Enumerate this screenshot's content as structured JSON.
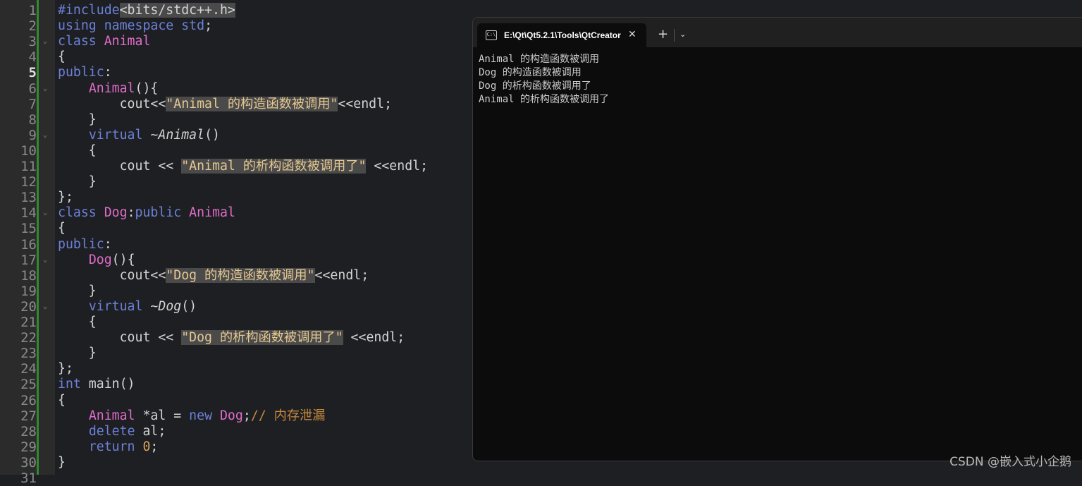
{
  "editor": {
    "line_numbers": [
      "1",
      "2",
      "3",
      "4",
      "5",
      "6",
      "7",
      "8",
      "9",
      "10",
      "11",
      "12",
      "13",
      "14",
      "15",
      "16",
      "17",
      "18",
      "19",
      "20",
      "21",
      "22",
      "23",
      "24",
      "25",
      "26",
      "27",
      "28",
      "29",
      "30",
      "31"
    ],
    "current_line": 5,
    "fold_lines": [
      3,
      6,
      9,
      14,
      17,
      20
    ],
    "code": [
      [
        [
          "pp",
          "#include"
        ],
        [
          "inc",
          "<bits/stdc++.h>"
        ]
      ],
      [
        [
          "kw",
          "using"
        ],
        [
          "plain",
          " "
        ],
        [
          "kw",
          "namespace"
        ],
        [
          "plain",
          " "
        ],
        [
          "kw",
          "std"
        ],
        [
          "plain",
          ";"
        ]
      ],
      [
        [
          "kw",
          "class"
        ],
        [
          "plain",
          " "
        ],
        [
          "cls",
          "Animal"
        ]
      ],
      [
        [
          "plain",
          "{"
        ]
      ],
      [
        [
          "kw",
          "public"
        ],
        [
          "plain",
          ":"
        ]
      ],
      [
        [
          "plain",
          "    "
        ],
        [
          "fn",
          "Animal"
        ],
        [
          "plain",
          "(){"
        ]
      ],
      [
        [
          "plain",
          "        cout<<"
        ],
        [
          "str",
          "\"Animal 的构造函数被调用\""
        ],
        [
          "plain",
          "<<endl;"
        ]
      ],
      [
        [
          "plain",
          "    }"
        ]
      ],
      [
        [
          "plain",
          "    "
        ],
        [
          "kw",
          "virtual"
        ],
        [
          "plain",
          " ~"
        ],
        [
          "it",
          "Animal"
        ],
        [
          "plain",
          "()"
        ]
      ],
      [
        [
          "plain",
          "    {"
        ]
      ],
      [
        [
          "plain",
          "        cout << "
        ],
        [
          "str",
          "\"Animal 的析构函数被调用了\""
        ],
        [
          "plain",
          " <<endl;"
        ]
      ],
      [
        [
          "plain",
          "    }"
        ]
      ],
      [
        [
          "plain",
          "};"
        ]
      ],
      [
        [
          "kw",
          "class"
        ],
        [
          "plain",
          " "
        ],
        [
          "cls",
          "Dog"
        ],
        [
          "plain",
          ":"
        ],
        [
          "kw",
          "public"
        ],
        [
          "plain",
          " "
        ],
        [
          "cls",
          "Animal"
        ]
      ],
      [
        [
          "plain",
          "{"
        ]
      ],
      [
        [
          "kw",
          "public"
        ],
        [
          "plain",
          ":"
        ]
      ],
      [
        [
          "plain",
          "    "
        ],
        [
          "fn",
          "Dog"
        ],
        [
          "plain",
          "(){"
        ]
      ],
      [
        [
          "plain",
          "        cout<<"
        ],
        [
          "str",
          "\"Dog 的构造函数被调用\""
        ],
        [
          "plain",
          "<<endl;"
        ]
      ],
      [
        [
          "plain",
          "    }"
        ]
      ],
      [
        [
          "plain",
          "    "
        ],
        [
          "kw",
          "virtual"
        ],
        [
          "plain",
          " ~"
        ],
        [
          "it",
          "Dog"
        ],
        [
          "plain",
          "()"
        ]
      ],
      [
        [
          "plain",
          "    {"
        ]
      ],
      [
        [
          "plain",
          "        cout << "
        ],
        [
          "str",
          "\"Dog 的析构函数被调用了\""
        ],
        [
          "plain",
          " <<endl;"
        ]
      ],
      [
        [
          "plain",
          "    }"
        ]
      ],
      [
        [
          "plain",
          "};"
        ]
      ],
      [
        [
          "kw",
          "int"
        ],
        [
          "plain",
          " main()"
        ]
      ],
      [
        [
          "plain",
          "{"
        ]
      ],
      [
        [
          "plain",
          "    "
        ],
        [
          "cls",
          "Animal"
        ],
        [
          "plain",
          " *al = "
        ],
        [
          "kw",
          "new"
        ],
        [
          "plain",
          " "
        ],
        [
          "cls",
          "Dog"
        ],
        [
          "plain",
          ";"
        ],
        [
          "cmt",
          "// 内存泄漏"
        ]
      ],
      [
        [
          "plain",
          "    "
        ],
        [
          "kw",
          "delete"
        ],
        [
          "plain",
          " al;"
        ]
      ],
      [
        [
          "plain",
          "    "
        ],
        [
          "kw",
          "return"
        ],
        [
          "plain",
          " "
        ],
        [
          "num",
          "0"
        ],
        [
          "plain",
          ";"
        ]
      ],
      [
        [
          "plain",
          "}"
        ]
      ],
      [
        [
          "plain",
          ""
        ]
      ]
    ]
  },
  "terminal": {
    "tab_title": "E:\\Qt\\Qt5.2.1\\Tools\\QtCreator",
    "tab_icon": "C:\\",
    "close_glyph": "✕",
    "new_tab_glyph": "+",
    "dropdown_glyph": "⌄",
    "output": [
      "Animal 的构造函数被调用",
      "Dog 的构造函数被调用",
      "Dog 的析构函数被调用了",
      "Animal 的析构函数被调用了"
    ]
  },
  "watermark": "CSDN @嵌入式小企鹅"
}
